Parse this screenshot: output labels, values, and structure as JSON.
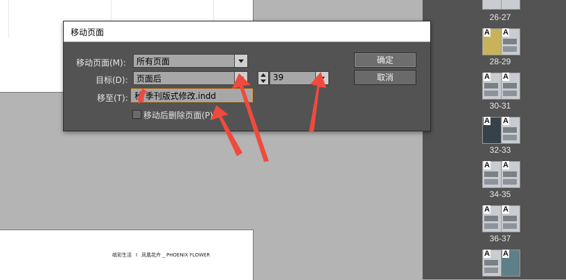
{
  "dialog": {
    "title": "移动页面",
    "move_pages_label": "移动页面(M):",
    "move_pages_value": "所有页面",
    "destination_label": "目标(D):",
    "destination_value": "页面后",
    "page_number_value": "39",
    "move_to_label": "移至(T):",
    "move_to_value": "秋  季刊版式修改.indd",
    "delete_after_move_label": "移动后删除页面(P)",
    "ok_label": "确定",
    "cancel_label": "取消"
  },
  "document": {
    "footer_left": "缤彩生活",
    "footer_sep": "I",
    "footer_mid": "凤凰花卉",
    "footer_right": "_ PHOENIX FLOWER"
  },
  "pages_panel": {
    "spreads": [
      {
        "label": "26-27"
      },
      {
        "label": "28-29"
      },
      {
        "label": "30-31"
      },
      {
        "label": "32-33"
      },
      {
        "label": "34-35"
      },
      {
        "label": "36-37"
      },
      {
        "label": ""
      }
    ],
    "master_letter": "A"
  },
  "annotation_color": "#f04a3e"
}
